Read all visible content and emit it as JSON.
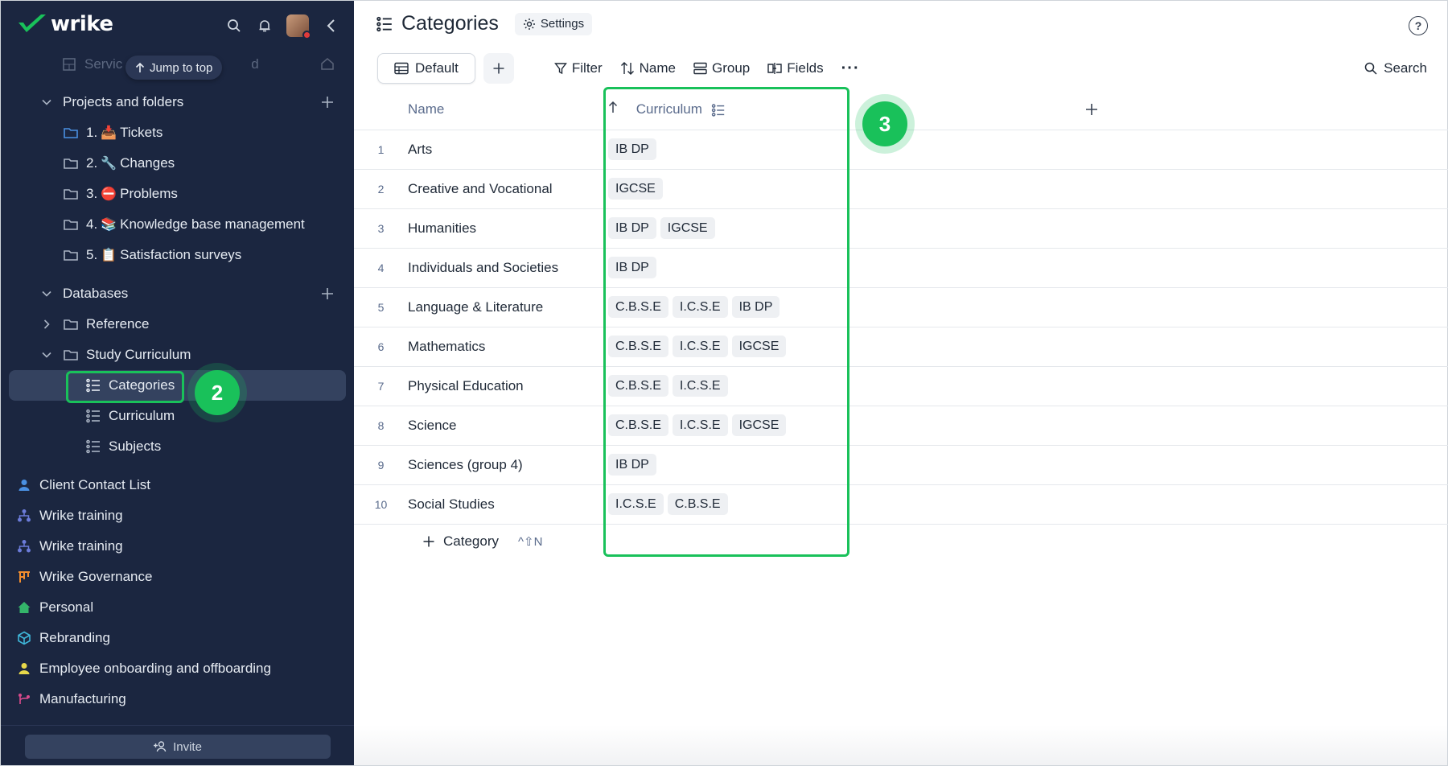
{
  "app": {
    "logo_text": "wrike"
  },
  "sidebar": {
    "ghost_item": "Servic",
    "ghost_tail": "d",
    "jump_to_top": "Jump to top",
    "projects_section": "Projects and folders",
    "projects": [
      {
        "num": "1.",
        "emoji": "📥",
        "label": "Tickets"
      },
      {
        "num": "2.",
        "emoji": "🔧",
        "label": "Changes"
      },
      {
        "num": "3.",
        "emoji": "⛔",
        "label": "Problems"
      },
      {
        "num": "4.",
        "emoji": "📚",
        "label": "Knowledge base management"
      },
      {
        "num": "5.",
        "emoji": "📋",
        "label": "Satisfaction surveys"
      }
    ],
    "databases_section": "Databases",
    "reference_folder": "Reference",
    "study_folder": "Study Curriculum",
    "databases": [
      {
        "label": "Categories",
        "selected": true
      },
      {
        "label": "Curriculum"
      },
      {
        "label": "Subjects"
      }
    ],
    "spaces": [
      {
        "label": "Client Contact List",
        "icon": "person-icon",
        "color": "#4a90e2"
      },
      {
        "label": "Wrike training",
        "icon": "hierarchy-icon",
        "color": "#6c7cd9"
      },
      {
        "label": "Wrike training",
        "icon": "hierarchy-icon",
        "color": "#6c7cd9"
      },
      {
        "label": "Wrike Governance",
        "icon": "board-icon",
        "color": "#f08c2e"
      },
      {
        "label": "Personal",
        "icon": "home-icon",
        "color": "#34b56a"
      },
      {
        "label": "Rebranding",
        "icon": "cube-icon",
        "color": "#3fb6d9"
      },
      {
        "label": "Employee onboarding and offboarding",
        "icon": "person-icon",
        "color": "#e8d84a"
      },
      {
        "label": "Manufacturing",
        "icon": "branch-icon",
        "color": "#d94a8c"
      }
    ],
    "invite_label": "Invite"
  },
  "callouts": {
    "sidebar_step": "2",
    "column_step": "3"
  },
  "main": {
    "title": "Categories",
    "settings_label": "Settings",
    "help_glyph": "?",
    "toolbar": {
      "view_label": "Default",
      "filter_label": "Filter",
      "sort_label": "Name",
      "group_label": "Group",
      "fields_label": "Fields",
      "more_label": "···",
      "search_label": "Search"
    },
    "columns": {
      "name": "Name",
      "curriculum": "Curriculum"
    },
    "rows": [
      {
        "n": "1",
        "name": "Arts",
        "tags": [
          "IB DP"
        ]
      },
      {
        "n": "2",
        "name": "Creative and Vocational",
        "tags": [
          "IGCSE"
        ]
      },
      {
        "n": "3",
        "name": "Humanities",
        "tags": [
          "IB DP",
          "IGCSE"
        ]
      },
      {
        "n": "4",
        "name": "Individuals and Societies",
        "tags": [
          "IB DP"
        ]
      },
      {
        "n": "5",
        "name": "Language & Literature",
        "tags": [
          "C.B.S.E",
          "I.C.S.E",
          "IB DP"
        ]
      },
      {
        "n": "6",
        "name": "Mathematics",
        "tags": [
          "C.B.S.E",
          "I.C.S.E",
          "IGCSE"
        ]
      },
      {
        "n": "7",
        "name": "Physical Education",
        "tags": [
          "C.B.S.E",
          "I.C.S.E"
        ]
      },
      {
        "n": "8",
        "name": "Science",
        "tags": [
          "C.B.S.E",
          "I.C.S.E",
          "IGCSE"
        ]
      },
      {
        "n": "9",
        "name": "Sciences (group 4)",
        "tags": [
          "IB DP"
        ]
      },
      {
        "n": "10",
        "name": "Social Studies",
        "tags": [
          "I.C.S.E",
          "C.B.S.E"
        ]
      }
    ],
    "add_row_label": "Category",
    "add_row_shortcut": "^⇧N"
  },
  "colors": {
    "sidebar_bg": "#1b2640",
    "accent_green": "#19c15a",
    "selected_bg": "#34425f"
  }
}
